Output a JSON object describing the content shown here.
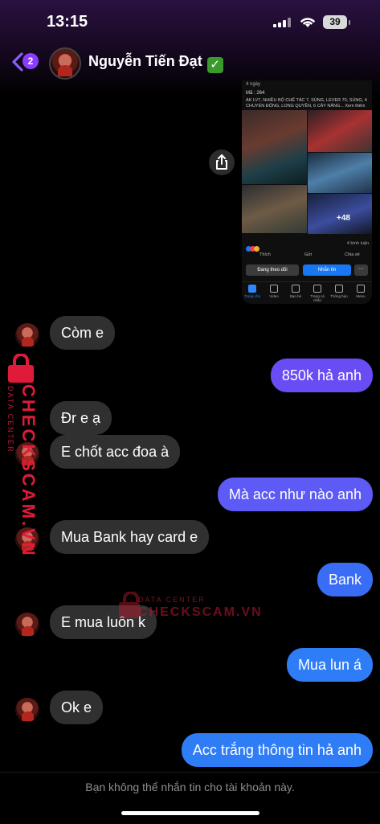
{
  "status_bar": {
    "time": "13:15",
    "battery": "39"
  },
  "header": {
    "back_count": "2",
    "contact_name": "Nguyễn Tiến Đạt",
    "verified_emoji": "✓"
  },
  "shared_post": {
    "meta": "4 ngày",
    "code": "Mã : 264",
    "description": "AK LV7, NHIỀU BỘ CHẾ TÁC 7, SÚNG, LEVER 70, SÚNG, 4 CHUYỂN ĐỘNG, LONG QUYỀN, 6 CÂY NÂNG... Xem thêm",
    "overlay_count": "+48",
    "comments": "4 bình luận",
    "actions": [
      "Thích",
      "Gửi",
      "Chia sẻ"
    ],
    "follow_label": "Đang theo dõi",
    "message_label": "Nhắn tin",
    "more_label": "···",
    "tabs": [
      "Trang chủ",
      "Video",
      "Bạn bè",
      "Trang cá nhân",
      "Thông báo",
      "Menu"
    ]
  },
  "messages": [
    {
      "from": "them",
      "text": "Còm e"
    },
    {
      "from": "me",
      "text": "850k hả anh"
    },
    {
      "from": "them",
      "text": "Đr e ạ"
    },
    {
      "from": "them",
      "text": "E chốt acc đoa à"
    },
    {
      "from": "me",
      "text": "Mà acc như nào anh"
    },
    {
      "from": "them",
      "text": "Mua Bank hay card e"
    },
    {
      "from": "me",
      "text": "Bank"
    },
    {
      "from": "them",
      "text": "E mua luôn k"
    },
    {
      "from": "me",
      "text": "Mua lun á"
    },
    {
      "from": "them",
      "text": "Ok e"
    },
    {
      "from": "me",
      "text": "Acc trắng thông tin hả anh"
    }
  ],
  "watermark": {
    "small": "DATA CENTER",
    "big": "CHECKSCAM.VN"
  },
  "footer": {
    "notice": "Bạn không thể nhắn tin cho tài khoản này."
  }
}
